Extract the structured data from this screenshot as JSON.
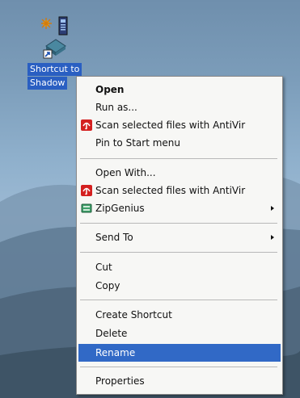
{
  "desktop": {
    "icon": {
      "label_line1": "Shortcut to",
      "label_line2": "Shadow",
      "icon_name": "shortcut-application-icon"
    }
  },
  "context_menu": {
    "items": [
      {
        "label": "Open",
        "bold": true
      },
      {
        "label": "Run as..."
      },
      {
        "label": "Scan selected files with AntiVir",
        "icon": "antivir-umbrella-icon"
      },
      {
        "label": "Pin to Start menu"
      },
      {
        "label": "Open With..."
      },
      {
        "label": "Scan selected files with AntiVir",
        "icon": "antivir-umbrella-icon"
      },
      {
        "label": "ZipGenius",
        "icon": "zipgenius-icon",
        "submenu": true
      },
      {
        "label": "Send To",
        "submenu": true
      },
      {
        "label": "Cut"
      },
      {
        "label": "Copy"
      },
      {
        "label": "Create Shortcut"
      },
      {
        "label": "Delete"
      },
      {
        "label": "Rename",
        "selected": true
      },
      {
        "label": "Properties"
      }
    ]
  },
  "colors": {
    "selection": "#3169c6",
    "menu_background": "#f7f7f5",
    "antivir_red": "#d42020"
  }
}
